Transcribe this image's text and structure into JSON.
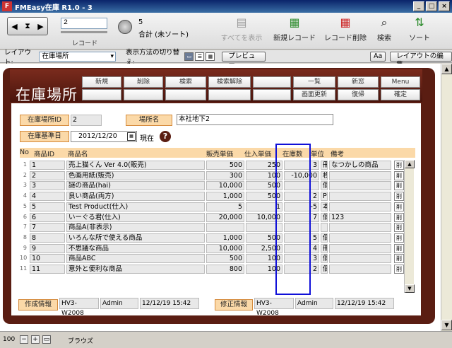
{
  "window": {
    "title": "FMEasy在庫 R1.0 - 3",
    "icon": "app-icon",
    "buttons": [
      "_",
      "□",
      "×"
    ]
  },
  "toolbar": {
    "record_value": "2",
    "record_label": "レコード",
    "count": "5",
    "count_label": "合計 (未ソート)",
    "show_all": "すべてを表示",
    "new_record": "新規レコード",
    "delete_record": "レコード削除",
    "search": "検索",
    "sort": "ソート"
  },
  "layoutbar": {
    "layout_label": "レイアウト:",
    "layout_value": "在庫場所",
    "view_label": "表示方法の切り替え:",
    "preview": "プレビュー",
    "aa": "Aa",
    "edit_layout": "レイアウトの編集"
  },
  "header": {
    "title": "在庫場所",
    "row1": [
      "新規",
      "削除",
      "検索",
      "検索解除",
      "",
      "一覧",
      "新窓",
      "Menu"
    ],
    "row2": [
      "",
      "",
      "",
      "",
      "",
      "画面更新",
      "復帰",
      "確定"
    ]
  },
  "form": {
    "location_id_label": "在庫場所ID",
    "location_id": "2",
    "location_name_label": "場所名",
    "location_name": "本社地下2",
    "date_label": "在庫基準日",
    "date": "2012/12/20",
    "now_label": "現在",
    "help": "?"
  },
  "table": {
    "headers": {
      "no": "No",
      "pid": "商品ID",
      "name": "商品名",
      "price": "販売単価",
      "cost": "仕入単価",
      "stock": "在庫数",
      "unit": "単位",
      "note": "備考"
    },
    "delete_label": "削",
    "rows": [
      {
        "no": "1",
        "pid": "1",
        "name": "売上猫くん Ver 4.0(販売)",
        "price": "500",
        "cost": "250",
        "stock": "3",
        "unit": "冊",
        "note": "なつかしの商品"
      },
      {
        "no": "2",
        "pid": "2",
        "name": "色画用紙(販売)",
        "price": "300",
        "cost": "100",
        "stock": "-10,000",
        "unit": "枚",
        "note": ""
      },
      {
        "no": "3",
        "pid": "3",
        "name": "謎の商品(hai)",
        "price": "10,000",
        "cost": "500",
        "stock": "",
        "unit": "個",
        "note": ""
      },
      {
        "no": "4",
        "pid": "4",
        "name": "良い商品(両方)",
        "price": "1,000",
        "cost": "500",
        "stock": "2",
        "unit": "PCS",
        "note": ""
      },
      {
        "no": "5",
        "pid": "5",
        "name": "Test Product(仕入)",
        "price": "5",
        "cost": "1",
        "stock": "-5",
        "unit": "本",
        "note": ""
      },
      {
        "no": "6",
        "pid": "6",
        "name": "いーぐる君(仕入)",
        "price": "20,000",
        "cost": "10,000",
        "stock": "7",
        "unit": "個",
        "note": "123"
      },
      {
        "no": "7",
        "pid": "7",
        "name": "商品A(非表示)",
        "price": "",
        "cost": "",
        "stock": "",
        "unit": "",
        "note": ""
      },
      {
        "no": "8",
        "pid": "8",
        "name": "いろんな所で使える商品",
        "price": "1,000",
        "cost": "500",
        "stock": "5",
        "unit": "個",
        "note": ""
      },
      {
        "no": "9",
        "pid": "9",
        "name": "不思議な商品",
        "price": "10,000",
        "cost": "2,500",
        "stock": "4",
        "unit": "冊",
        "note": ""
      },
      {
        "no": "10",
        "pid": "10",
        "name": "商品ABC",
        "price": "500",
        "cost": "100",
        "stock": "3",
        "unit": "個",
        "note": ""
      },
      {
        "no": "11",
        "pid": "11",
        "name": "意外と便利な商品",
        "price": "800",
        "cost": "100",
        "stock": "2",
        "unit": "個",
        "note": ""
      }
    ]
  },
  "footer": {
    "created_label": "作成情報",
    "created_host": "HV3-W2008",
    "created_user": "Admin",
    "created_at": "12/12/19 15:42",
    "modified_label": "修正情報",
    "modified_host": "HV3-W2008",
    "modified_user": "Admin",
    "modified_at": "12/12/19 15:42"
  },
  "status": {
    "zoom": "100",
    "mode": "ブラウズ"
  },
  "colors": {
    "accent": "#5a1d12",
    "label_bg": "#fbd9a8",
    "highlight": "#1010d8"
  }
}
